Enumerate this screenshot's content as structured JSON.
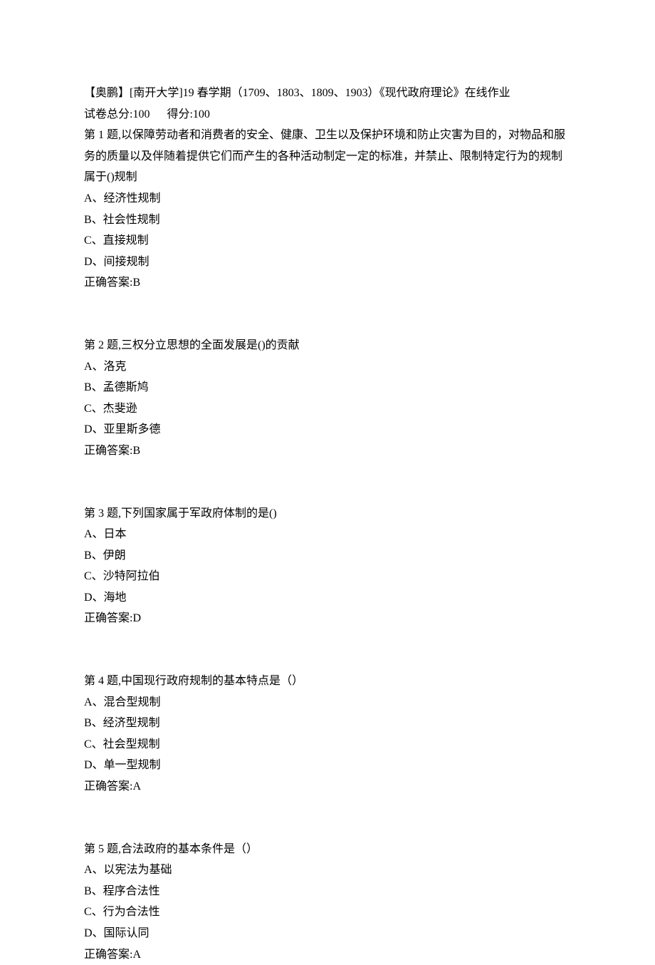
{
  "header": {
    "title_line": "【奥鹏】[南开大学]19 春学期（1709、1803、1809、1903）《现代政府理论》在线作业",
    "score_line": "试卷总分:100      得分:100"
  },
  "questions": [
    {
      "prompt": "第 1 题,以保障劳动者和消费者的安全、健康、卫生以及保护环境和防止灾害为目的，对物品和服务的质量以及伴随着提供它们而产生的各种活动制定一定的标准，并禁止、限制特定行为的规制属于()规制",
      "options": [
        "A、经济性规制",
        "B、社会性规制",
        "C、直接规制",
        "D、间接规制"
      ],
      "answer": "正确答案:B"
    },
    {
      "prompt": "第 2 题,三权分立思想的全面发展是()的贡献",
      "options": [
        "A、洛克",
        "B、孟德斯鸠",
        "C、杰斐逊",
        "D、亚里斯多德"
      ],
      "answer": "正确答案:B"
    },
    {
      "prompt": "第 3 题,下列国家属于军政府体制的是()",
      "options": [
        "A、日本",
        "B、伊朗",
        "C、沙特阿拉伯",
        "D、海地"
      ],
      "answer": "正确答案:D"
    },
    {
      "prompt": "第 4 题,中国现行政府规制的基本特点是（）",
      "options": [
        "A、混合型规制",
        "B、经济型规制",
        "C、社会型规制",
        "D、单一型规制"
      ],
      "answer": "正确答案:A"
    },
    {
      "prompt": "第 5 题,合法政府的基本条件是（）",
      "options": [
        "A、以宪法为基础",
        "B、程序合法性",
        "C、行为合法性",
        "D、国际认同"
      ],
      "answer": "正确答案:A"
    }
  ]
}
